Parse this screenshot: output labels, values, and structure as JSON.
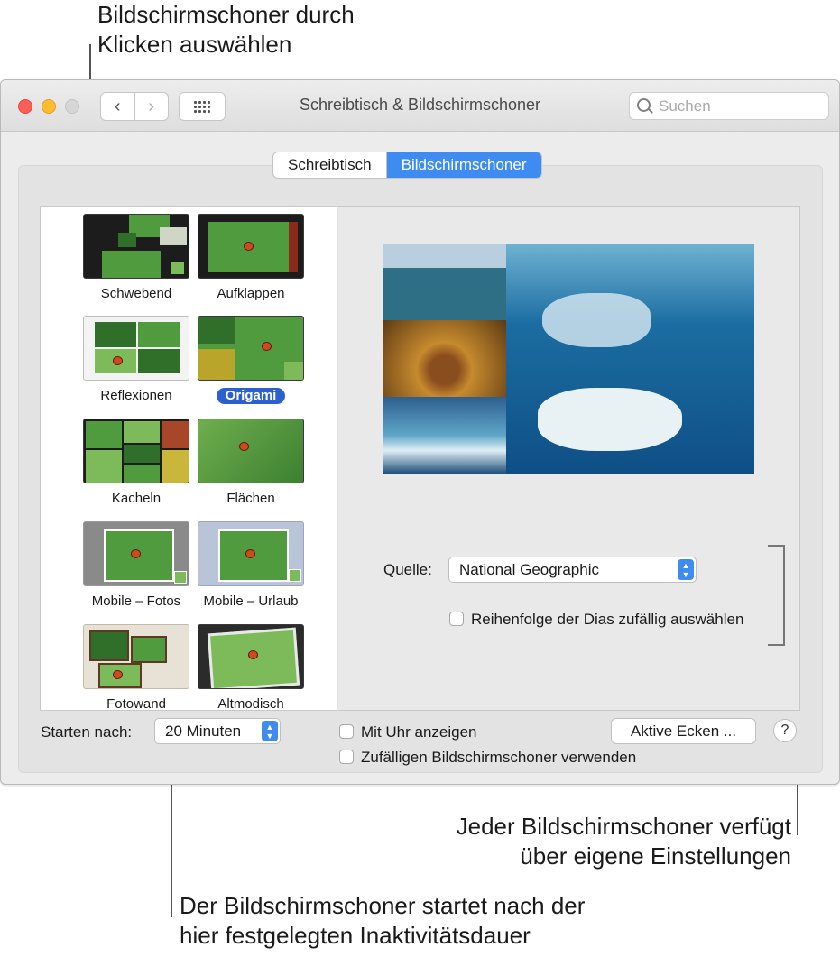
{
  "callouts": {
    "top": [
      "Bildschirmschoner durch",
      "Klicken auswählen"
    ],
    "right": [
      "Jeder Bildschirmschoner verfügt",
      "über eigene Einstellungen"
    ],
    "bottom": [
      "Der Bildschirmschoner startet nach der",
      "hier festgelegten Inaktivitätsdauer"
    ]
  },
  "window": {
    "title": "Schreibtisch & Bildschirmschoner",
    "search_placeholder": "Suchen",
    "nav_back": "‹",
    "nav_forward": "›"
  },
  "tabs": [
    {
      "label": "Schreibtisch",
      "selected": false
    },
    {
      "label": "Bildschirmschoner",
      "selected": true
    }
  ],
  "screensavers": [
    {
      "label": "Schwebend",
      "selected": false
    },
    {
      "label": "Aufklappen",
      "selected": false
    },
    {
      "label": "Reflexionen",
      "selected": false
    },
    {
      "label": "Origami",
      "selected": true
    },
    {
      "label": "Kacheln",
      "selected": false
    },
    {
      "label": "Flächen",
      "selected": false
    },
    {
      "label": "Mobile – Fotos",
      "selected": false
    },
    {
      "label": "Mobile – Urlaub",
      "selected": false
    },
    {
      "label": "Fotowand",
      "selected": false
    },
    {
      "label": "Altmodisch",
      "selected": false
    }
  ],
  "settings": {
    "source_label": "Quelle:",
    "source_value": "National Geographic",
    "shuffle_label": "Reihenfolge der Dias zufällig auswählen",
    "shuffle_checked": false
  },
  "footer": {
    "start_label": "Starten nach:",
    "start_value": "20 Minuten",
    "clock_label": "Mit Uhr anzeigen",
    "clock_checked": false,
    "random_label": "Zufälligen Bildschirmschoner verwenden",
    "random_checked": false,
    "hot_corners_label": "Aktive Ecken ...",
    "help_label": "?"
  },
  "colors": {
    "accent": "#3e8cf2",
    "selection": "#2c5fd1"
  }
}
